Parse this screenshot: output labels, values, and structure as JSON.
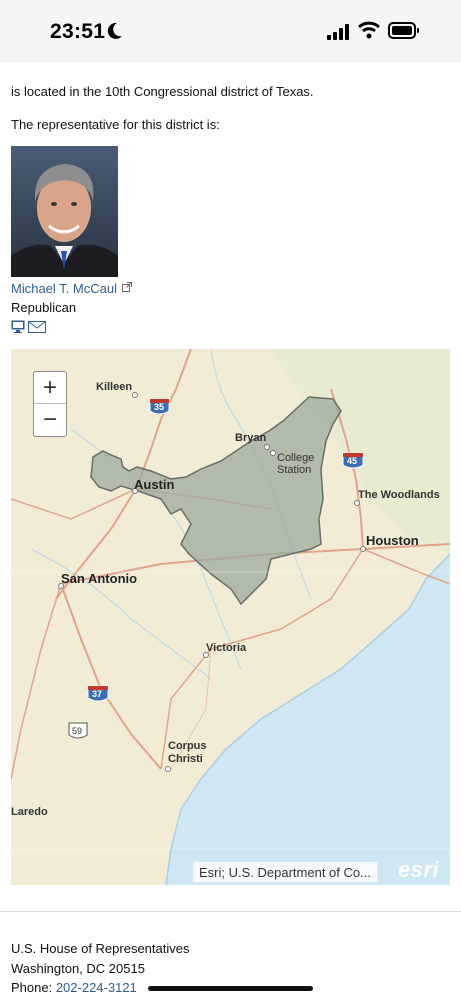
{
  "status_bar": {
    "time": "23:51"
  },
  "content": {
    "district_line": "is located in the 10th Congressional district of Texas.",
    "rep_intro": "The representative for this district is:",
    "representative": {
      "name": "Michael T. McCaul",
      "party": "Republican"
    }
  },
  "map": {
    "zoom_in": "+",
    "zoom_out": "−",
    "labels": {
      "killeen": "Killeen",
      "bryan": "Bryan",
      "college": "College",
      "station": "Station",
      "austin": "Austin",
      "woodlands": "The Woodlands",
      "houston": "Houston",
      "san_antonio": "San Antonio",
      "victoria": "Victoria",
      "corpus": "Corpus",
      "christi": "Christi",
      "laredo": "Laredo",
      "i35": "35",
      "i45": "45",
      "i37": "37",
      "us59": "59"
    },
    "attribution": "Esri; U.S. Department of Co...",
    "logo": "esri",
    "colors": {
      "land": "#f2ecd6",
      "water": "#cfe6f3",
      "district": "#9aab9a",
      "district_outline": "#6b6b6b",
      "highway": "#e0a48c"
    }
  },
  "footer": {
    "org": "U.S. House of Representatives",
    "address": "Washington, DC 20515",
    "phone_label": "Phone:",
    "phone": "202-224-3121"
  }
}
